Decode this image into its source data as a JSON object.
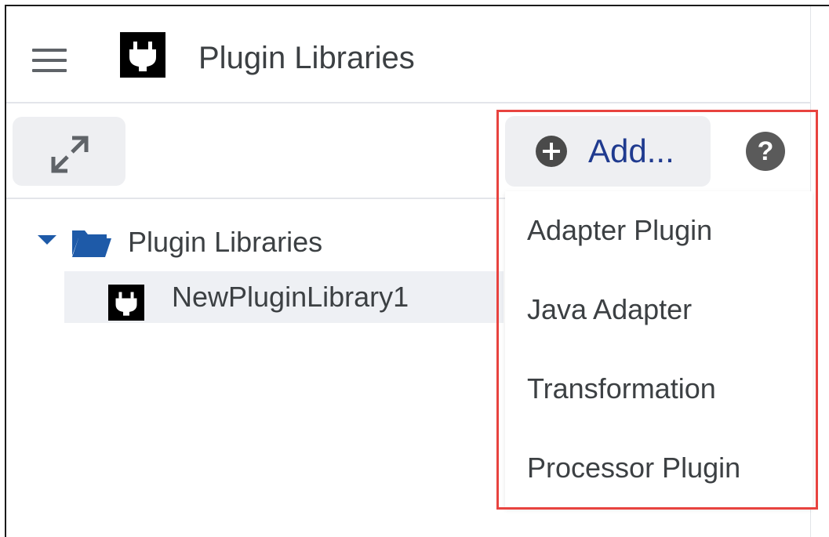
{
  "header": {
    "menu_icon": "hamburger-menu-icon",
    "logo_icon": "plug-icon",
    "title": "Plugin Libraries"
  },
  "toolbar": {
    "expand_icon": "expand-arrows-icon",
    "add_button_label": "Add...",
    "add_icon": "plus-circle-icon",
    "help_icon": "help-icon",
    "help_glyph": "?"
  },
  "tree": {
    "root": {
      "label": "Plugin Libraries",
      "icon": "folder-open-icon",
      "expanded": true
    },
    "children": [
      {
        "label": "NewPluginLibrary1",
        "icon": "plug-icon",
        "selected": true
      }
    ]
  },
  "add_menu": {
    "items": [
      {
        "label": "Adapter Plugin"
      },
      {
        "label": "Java Adapter"
      },
      {
        "label": "Transformation"
      },
      {
        "label": "Processor Plugin"
      }
    ]
  },
  "colors": {
    "accent_blue": "#1f3a8f",
    "folder_blue": "#1e5aa8",
    "highlight_red": "#e8433f",
    "button_bg": "#eeeff2"
  }
}
